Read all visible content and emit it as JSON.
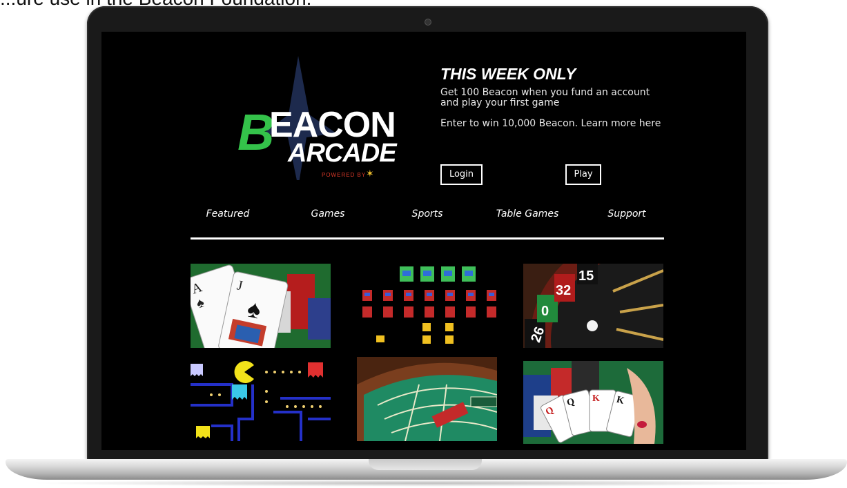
{
  "caption": "...ure use in the Beacon Foundation.",
  "logo": {
    "letter": "B",
    "word1": "EACON",
    "word2": "ARCADE",
    "powered": "POWERED BY"
  },
  "promo": {
    "title": "THIS WEEK ONLY",
    "line1": "Get 100 Beacon when you fund an account",
    "line2": "and play your first game",
    "line3": "Enter to win 10,000 Beacon. Learn more here"
  },
  "buttons": {
    "login": "Login",
    "play": "Play"
  },
  "nav": [
    "Featured",
    "Games",
    "Sports",
    "Table Games",
    "Support"
  ],
  "tiles": [
    {
      "name": "blackjack-tile",
      "icon": "blackjack-cards"
    },
    {
      "name": "galaga-tile",
      "icon": "space-invaders"
    },
    {
      "name": "roulette-tile",
      "icon": "roulette-wheel"
    },
    {
      "name": "pacman-tile",
      "icon": "pacman-maze"
    },
    {
      "name": "craps-tile",
      "icon": "craps-table"
    },
    {
      "name": "poker-tile",
      "icon": "poker-hand"
    }
  ],
  "colors": {
    "accent_green": "#34c24a",
    "background": "#000000",
    "text": "#ffffff"
  }
}
